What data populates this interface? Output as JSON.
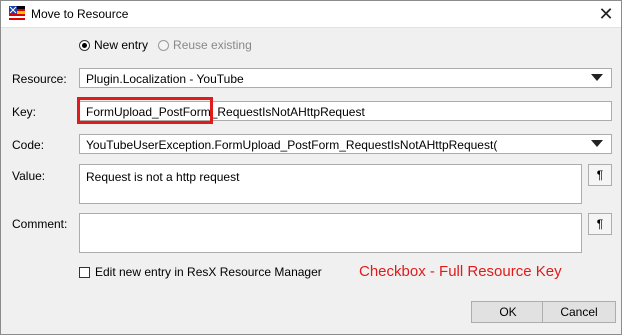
{
  "window": {
    "title": "Move to Resource"
  },
  "entry_mode": {
    "options": [
      {
        "label": "New entry",
        "checked": true,
        "enabled": true
      },
      {
        "label": "Reuse existing",
        "checked": false,
        "enabled": false
      }
    ]
  },
  "form": {
    "resource_label": "Resource:",
    "resource_value": "Plugin.Localization - YouTube",
    "key_label": "Key:",
    "key_value": "FormUpload_PostForm_RequestIsNotAHttpRequest",
    "code_label": "Code:",
    "code_value": "YouTubeUserException.FormUpload_PostForm_RequestIsNotAHttpRequest(",
    "value_label": "Value:",
    "value_text": "Request is not a http request",
    "comment_label": "Comment:",
    "comment_text": "",
    "pilcrow_glyph": "¶"
  },
  "edit_in_manager": {
    "label": "Edit new entry in ResX Resource Manager",
    "checked": false
  },
  "annotation": {
    "text": "Checkbox - Full Resource Key",
    "color": "#e01b1b"
  },
  "buttons": {
    "ok": "OK",
    "cancel": "Cancel"
  }
}
